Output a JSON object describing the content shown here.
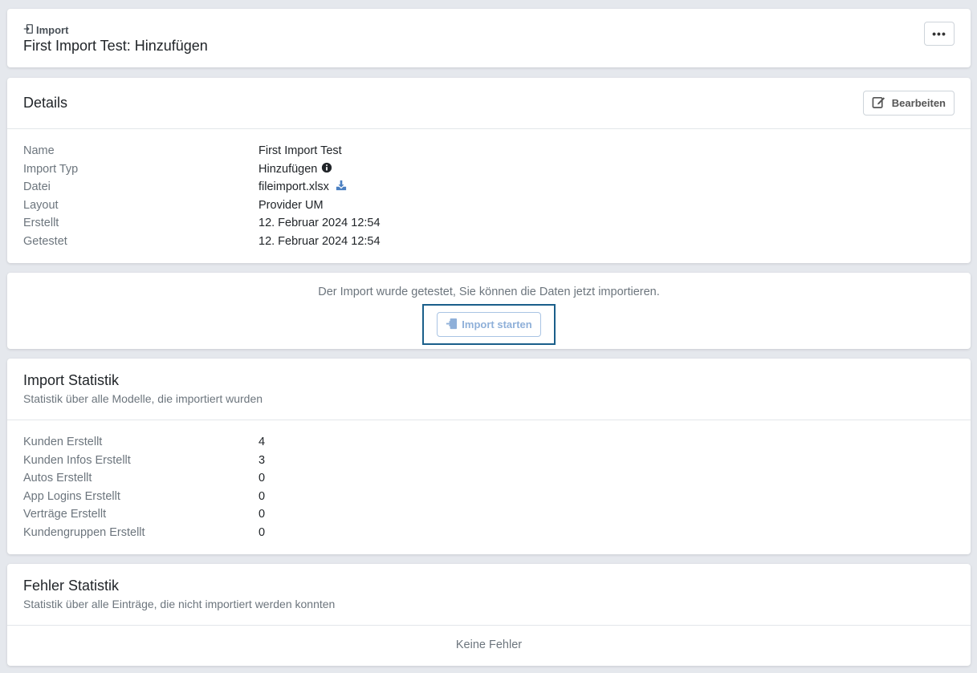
{
  "header": {
    "breadcrumb": "Import",
    "title": "First Import Test: Hinzufügen",
    "more_label": "•••"
  },
  "details": {
    "title": "Details",
    "edit_label": "Bearbeiten",
    "rows": [
      {
        "key": "Name",
        "value": "First Import Test"
      },
      {
        "key": "Import Typ",
        "value": "Hinzufügen"
      },
      {
        "key": "Datei",
        "value": "fileimport.xlsx"
      },
      {
        "key": "Layout",
        "value": "Provider UM"
      },
      {
        "key": "Erstellt",
        "value": "12. Februar 2024 12:54"
      },
      {
        "key": "Getestet",
        "value": "12. Februar 2024 12:54"
      }
    ]
  },
  "notice": {
    "text": "Der Import wurde getestet, Sie können die Daten jetzt importieren.",
    "button_label": "Import starten"
  },
  "stats": {
    "title": "Import Statistik",
    "subtitle": "Statistik über alle Modelle, die importiert wurden",
    "rows": [
      {
        "key": "Kunden Erstellt",
        "value": "4"
      },
      {
        "key": "Kunden Infos Erstellt",
        "value": "3"
      },
      {
        "key": "Autos Erstellt",
        "value": "0"
      },
      {
        "key": "App Logins Erstellt",
        "value": "0"
      },
      {
        "key": "Verträge Erstellt",
        "value": "0"
      },
      {
        "key": "Kundengruppen Erstellt",
        "value": "0"
      }
    ]
  },
  "errors": {
    "title": "Fehler Statistik",
    "subtitle": "Statistik über alle Einträge, die nicht importiert werden konnten",
    "empty_text": "Keine Fehler"
  },
  "colors": {
    "background": "#e5e8ed",
    "accent": "#4a7fc1",
    "focus_ring": "#1a5f8a",
    "muted_text": "#6c757d"
  },
  "icons": {
    "breadcrumb": "import-icon",
    "edit": "edit-icon",
    "info": "info-circle-icon",
    "download": "download-icon",
    "import_button": "import-icon"
  }
}
